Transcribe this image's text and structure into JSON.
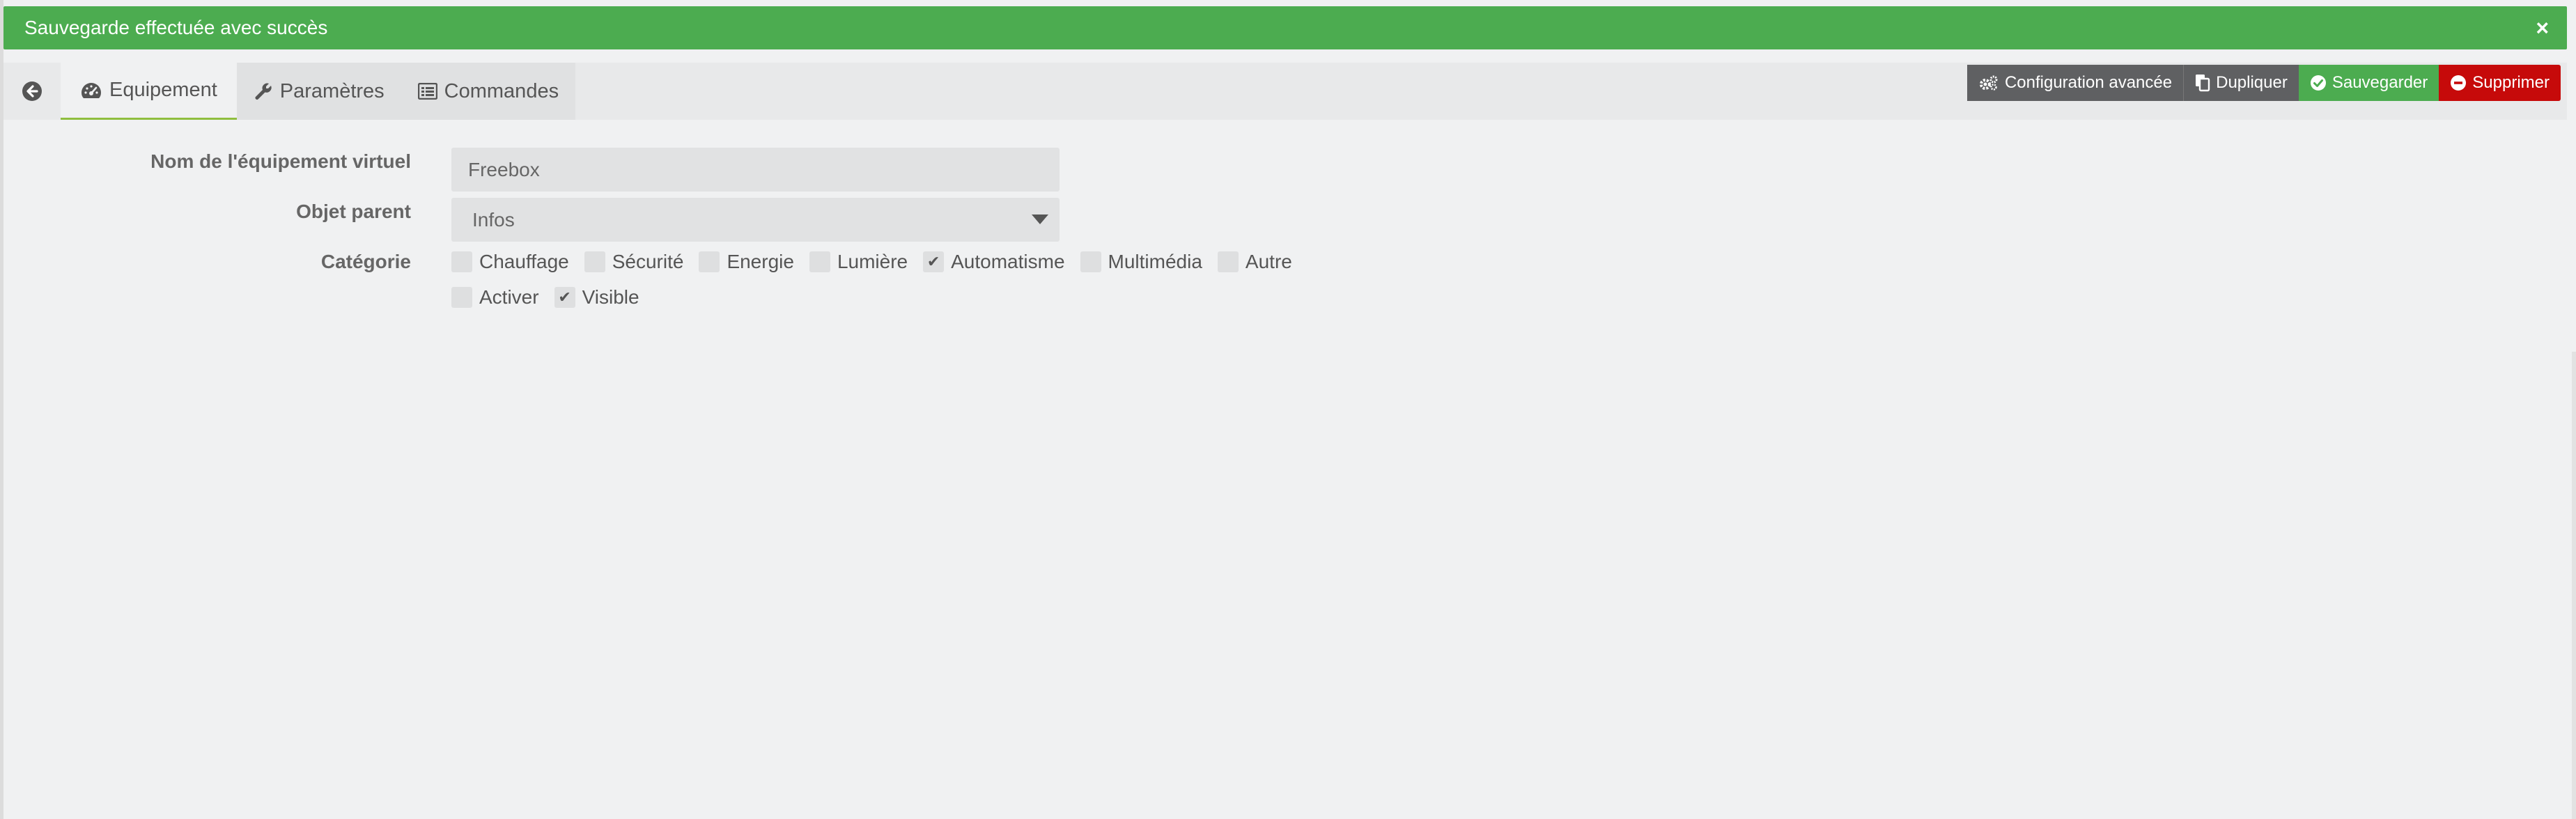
{
  "alert": {
    "message": "Sauvegarde effectuée avec succès",
    "close_label": "×",
    "color": "#4cac50"
  },
  "tabs": {
    "back_icon": "arrow-circle-left-icon",
    "items": [
      {
        "label": "Equipement",
        "icon": "tachometer-icon",
        "active": true
      },
      {
        "label": "Paramètres",
        "icon": "wrench-icon",
        "active": false
      },
      {
        "label": "Commandes",
        "icon": "list-icon",
        "active": false
      }
    ]
  },
  "actions": {
    "config_label": "Configuration avancée",
    "duplicate_label": "Dupliquer",
    "save_label": "Sauvegarder",
    "delete_label": "Supprimer",
    "colors": {
      "config": "#5f6062",
      "save": "#4cac50",
      "delete": "#c60a0a"
    }
  },
  "form": {
    "name_label": "Nom de l'équipement virtuel",
    "name_value": "Freebox",
    "parent_label": "Objet parent",
    "parent_value": "Infos",
    "category_label": "Catégorie",
    "categories": [
      {
        "label": "Chauffage",
        "checked": false
      },
      {
        "label": "Sécurité",
        "checked": false
      },
      {
        "label": "Energie",
        "checked": false
      },
      {
        "label": "Lumière",
        "checked": false
      },
      {
        "label": "Automatisme",
        "checked": true
      },
      {
        "label": "Multimédia",
        "checked": false
      },
      {
        "label": "Autre",
        "checked": false
      }
    ],
    "options": [
      {
        "label": "Activer",
        "checked": false
      },
      {
        "label": "Visible",
        "checked": true
      }
    ],
    "check_mark": "✔"
  }
}
